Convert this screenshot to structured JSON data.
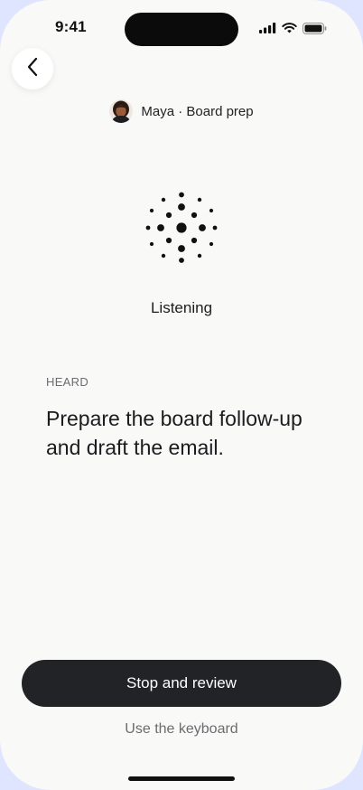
{
  "status_bar": {
    "time": "9:41",
    "icons": [
      "cellular-signal-icon",
      "wifi-icon",
      "battery-icon"
    ]
  },
  "nav": {
    "back_icon": "chevron-left-icon"
  },
  "context": {
    "label": "Maya · Board prep",
    "avatar": "person-avatar"
  },
  "listening": {
    "icon": "voice-dots-icon",
    "label": "Listening"
  },
  "heard": {
    "caption": "HEARD",
    "text": "Prepare the board follow-up and draft the email."
  },
  "actions": {
    "primary_label": "Stop and review",
    "secondary_label": "Use the keyboard"
  },
  "colors": {
    "background": "#f9f9f7",
    "primary_button": "#222326",
    "muted_text": "#6b6c70"
  }
}
